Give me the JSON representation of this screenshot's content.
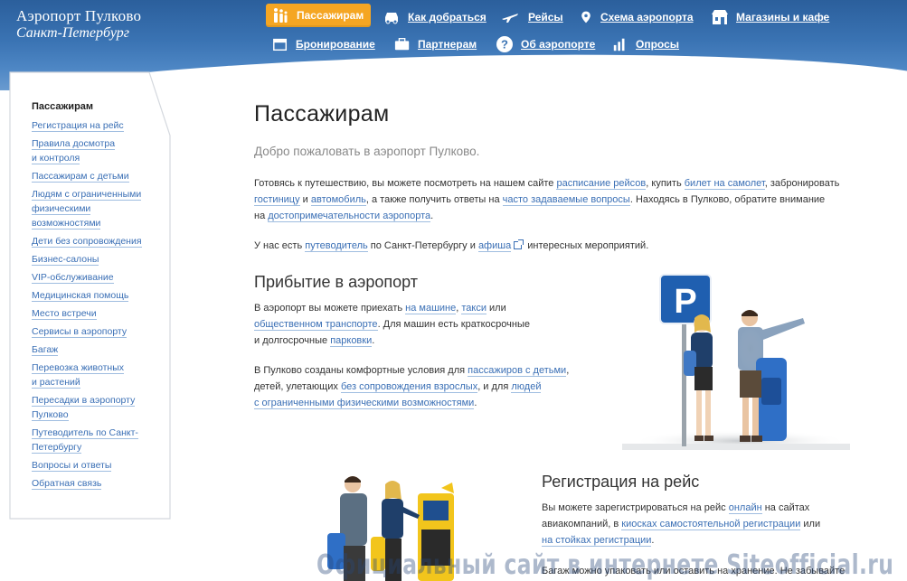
{
  "header": {
    "logo_line1": "Аэропорт Пулково",
    "logo_line2": "Санкт-Петербург",
    "nav": {
      "passengers": "Пассажирам",
      "how_to_get": "Как добраться",
      "flights": "Рейсы",
      "airport_map": "Схема аэропорта",
      "shops": "Магазины и кафе",
      "booking": "Бронирование",
      "partners": "Партнерам",
      "about": "Об аэропорте",
      "polls": "Опросы"
    },
    "active_color": "#f5a623"
  },
  "sidebar": {
    "title": "Пассажирам",
    "items": [
      [
        "Регистрация на рейс"
      ],
      [
        "Правила досмотра",
        "и контроля"
      ],
      [
        "Пассажирам с детьми"
      ],
      [
        "Людям с ограниченными",
        "физическими",
        "возможностями"
      ],
      [
        "Дети без сопровождения"
      ],
      [
        "Бизнес-салоны"
      ],
      [
        "VIP-обслуживание"
      ],
      [
        "Медицинская помощь"
      ],
      [
        "Место встречи"
      ],
      [
        "Сервисы в аэропорту"
      ],
      [
        "Багаж"
      ],
      [
        "Перевозка животных",
        "и растений"
      ],
      [
        "Пересадки в аэропорту",
        "Пулково"
      ],
      [
        "Путеводитель по Санкт-",
        "Петербургу"
      ],
      [
        "Вопросы и ответы"
      ],
      [
        "Обратная связь"
      ]
    ]
  },
  "main": {
    "title": "Пассажирам",
    "lead": "Добро пожаловать в аэропорт Пулково.",
    "intro": {
      "t1": "Готовясь к путешествию, вы можете посмотреть на нашем сайте ",
      "l1": "расписание рейсов",
      "t2": ", купить ",
      "l2": "билет на самолет",
      "t3": ", забронировать",
      "l3": "гостиницу",
      "t4": " и ",
      "l4": "автомобиль",
      "t5": ", а также получить ответы на ",
      "l5": "часто задаваемые вопросы",
      "t6": ". Находясь в Пулково, обратите внимание",
      "t7": "на ",
      "l6": "достопримечательности аэропорта",
      "t8": "."
    },
    "guide": {
      "t1": "У нас есть ",
      "l1": "путеводитель",
      "t2": " по Санкт-Петербургу и ",
      "l2": "афиша",
      "t3": " интересных мероприятий."
    },
    "arrival": {
      "title": "Прибытие в аэропорт",
      "t1": "В аэропорт вы можете приехать ",
      "l1": "на машине",
      "t2": ", ",
      "l2": "такси",
      "t3": " или",
      "l3": "общественном транспорте",
      "t4": ". Для машин есть краткосрочные",
      "t5": "и долгосрочные ",
      "l4": "парковки",
      "t6": "."
    },
    "comfort": {
      "t1": "В Пулково созданы комфортные условия для ",
      "l1": "пассажиров с детьми",
      "t2": ",",
      "t3": "детей, улетающих ",
      "l2": "без сопровождения взрослых",
      "t4": ", и для ",
      "l3": "людей",
      "l4": "с ограниченными физическими возможностями",
      "t5": "."
    },
    "registration": {
      "title": "Регистрация на рейс",
      "t1": "Вы можете зарегистрироваться на рейс ",
      "l1": "онлайн",
      "t2": " на сайтах",
      "t3": "авиакомпаний, в ",
      "l2": "киосках самостоятельной регистрации",
      "t4": " или",
      "l3": "на стойках регистрации",
      "t5": ".",
      "t6": "Багаж можно упаковать или оставить на хранение. Не забывайте"
    },
    "parking_sign": "P"
  },
  "watermark": "Официальный сайт в интернете Siteofficial.ru"
}
